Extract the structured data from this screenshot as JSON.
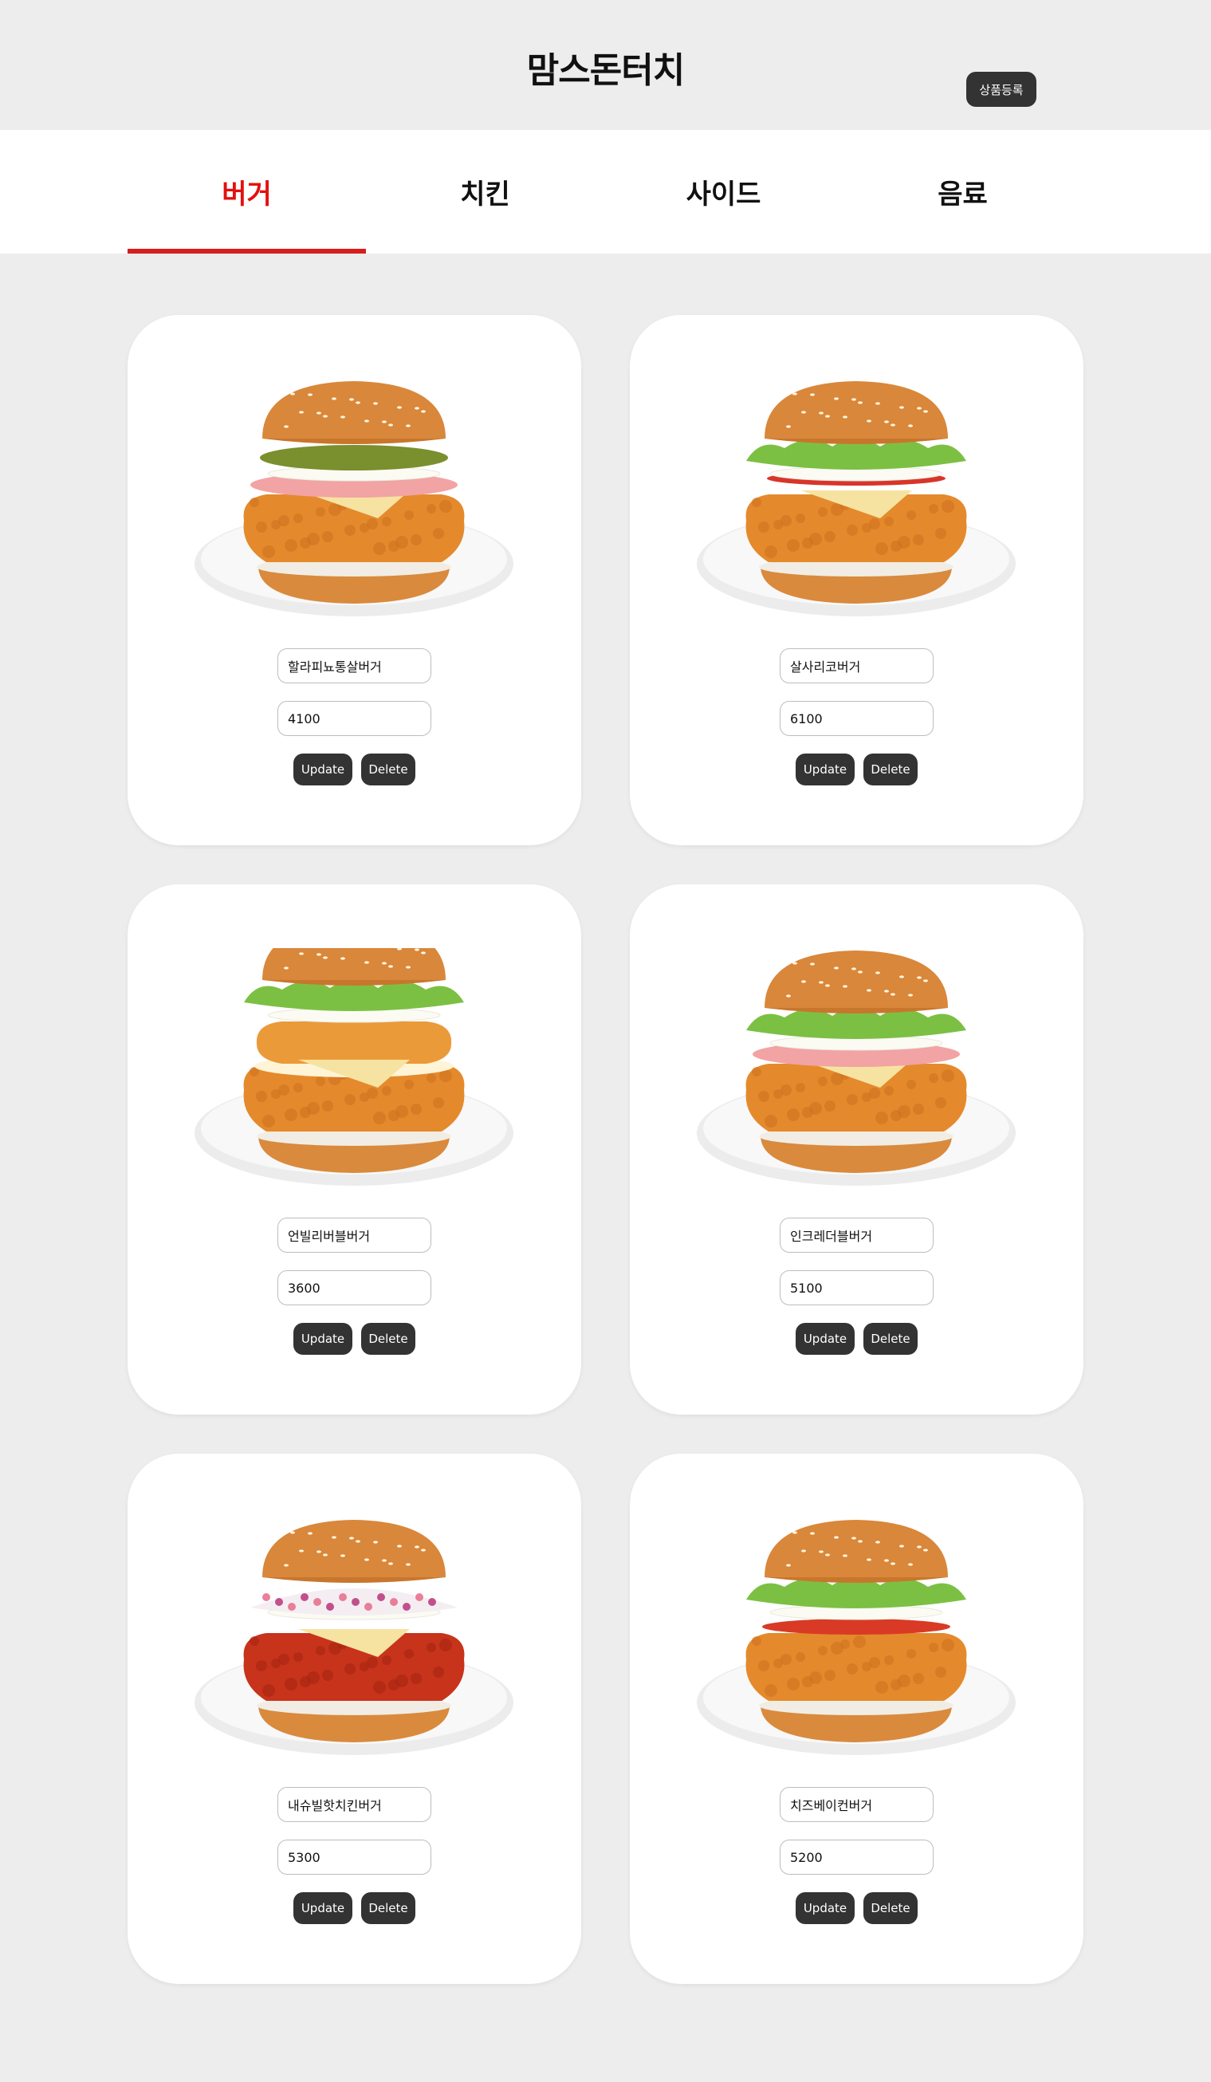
{
  "header": {
    "brand": "맘스돈터치",
    "register_label": "상품등록"
  },
  "tabs": [
    {
      "label": "버거",
      "active": true
    },
    {
      "label": "치킨",
      "active": false
    },
    {
      "label": "사이드",
      "active": false
    },
    {
      "label": "음료",
      "active": false
    }
  ],
  "products": [
    {
      "name": "할라피뇨통살버거",
      "price": "4100",
      "update_label": "Update",
      "delete_label": "Delete",
      "variant": "pickle-ham"
    },
    {
      "name": "살사리코버거",
      "price": "6100",
      "update_label": "Update",
      "delete_label": "Delete",
      "variant": "lettuce-salsa"
    },
    {
      "name": "언빌리버블버거",
      "price": "3600",
      "update_label": "Update",
      "delete_label": "Delete",
      "variant": "shrimp-double"
    },
    {
      "name": "인크레더블버거",
      "price": "5100",
      "update_label": "Update",
      "delete_label": "Delete",
      "variant": "lettuce-ham"
    },
    {
      "name": "내슈빌핫치킨버거",
      "price": "5300",
      "update_label": "Update",
      "delete_label": "Delete",
      "variant": "slaw-hot"
    },
    {
      "name": "치즈베이컨버거",
      "price": "5200",
      "update_label": "Update",
      "delete_label": "Delete",
      "variant": "lettuce-tomato"
    }
  ],
  "colors": {
    "accent": "#e3100f",
    "button": "#333333",
    "background": "#ededed"
  }
}
